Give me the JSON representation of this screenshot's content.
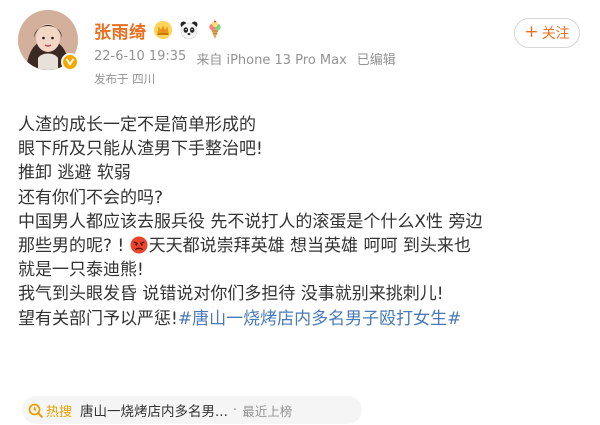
{
  "header": {
    "username": "张雨绮",
    "badges": [
      "crown-icon",
      "panda-icon",
      "ice-cream-icon"
    ],
    "verified": "verified-badge-icon",
    "date": "22-6-10 19:35",
    "source": "来自 iPhone 13 Pro Max",
    "edited": "已编辑",
    "location": "发布于 四川"
  },
  "follow_button": {
    "plus": "+",
    "label": "关注"
  },
  "post": {
    "lines": [
      "人渣的成长一定不是简单形成的",
      "眼下所及只能从渣男下手整治吧!",
      "推卸 逃避 软弱",
      "还有你们不会的吗?",
      "中国男人都应该去服兵役 先不说打人的滚蛋是个什么X性 旁边",
      "那些男的呢? !",
      "就是一只泰迪熊!",
      "我气到头眼发昏 说错说对你们多担待 没事就别来挑刺儿!",
      "望有关部门予以严惩!"
    ],
    "line6_after_emoji": "天天都说崇拜英雄 想当英雄 呵呵 到头来也",
    "hashtag": "#唐山一烧烤店内多名男子殴打女生#"
  },
  "hot_search": {
    "tag": "热搜",
    "topic": "唐山一烧烤店内多名男...",
    "separator": "·",
    "status": "最近上榜"
  },
  "colors": {
    "username": "#ea6f1f",
    "hashtag": "#4a7ab8",
    "meta": "#939393",
    "hot": "#e8a000"
  }
}
